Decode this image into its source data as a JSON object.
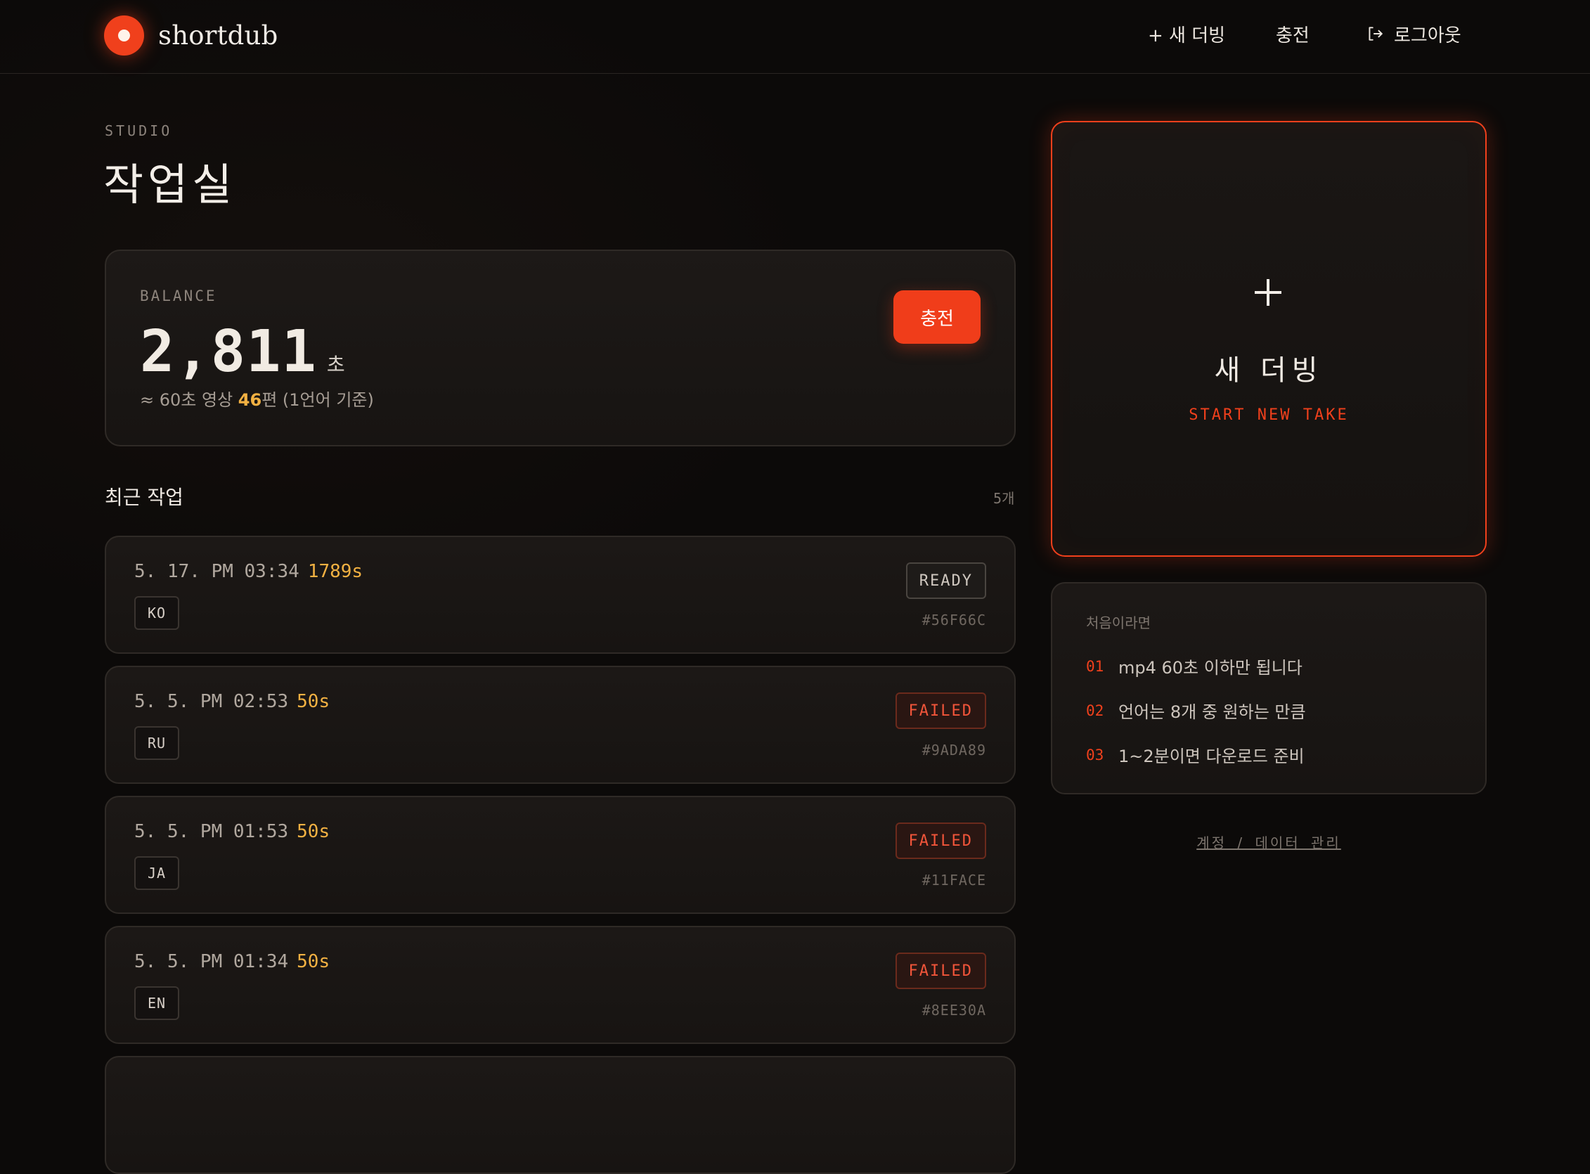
{
  "header": {
    "brand": "shortdub",
    "nav_new": "+ 새 더빙",
    "nav_charge": "충전",
    "nav_logout": "로그아웃"
  },
  "page": {
    "eyebrow": "STUDIO",
    "title": "작업실"
  },
  "balance": {
    "label": "BALANCE",
    "value": "2,811",
    "unit": "초",
    "note_prefix": "≈ 60초 영상 ",
    "note_count": "46",
    "note_suffix": "편 (1언어 기준)",
    "charge_label": "충전"
  },
  "recent": {
    "title": "최근 작업",
    "count": "5개",
    "jobs": [
      {
        "datetime": "5. 17. PM 03:34",
        "duration": "1789s",
        "lang": "KO",
        "status": "READY",
        "id": "#56F66C"
      },
      {
        "datetime": "5. 5. PM 02:53",
        "duration": "50s",
        "lang": "RU",
        "status": "FAILED",
        "id": "#9ADA89"
      },
      {
        "datetime": "5. 5. PM 01:53",
        "duration": "50s",
        "lang": "JA",
        "status": "FAILED",
        "id": "#11FACE"
      },
      {
        "datetime": "5. 5. PM 01:34",
        "duration": "50s",
        "lang": "EN",
        "status": "FAILED",
        "id": "#8EE30A"
      }
    ]
  },
  "new_dub": {
    "title": "새 더빙",
    "subtitle": "START NEW TAKE"
  },
  "guide": {
    "title": "처음이라면",
    "items": [
      {
        "num": "01",
        "text": "mp4 60초 이하만 됩니다"
      },
      {
        "num": "02",
        "text": "언어는 8개 중 원하는 만큼"
      },
      {
        "num": "03",
        "text": "1~2분이면 다운로드 준비"
      }
    ]
  },
  "footer": {
    "account_link": "계정 / 데이터 관리"
  },
  "colors": {
    "accent": "#f0401c",
    "highlight": "#f2b142",
    "background": "#0c0a09"
  },
  "icons": {
    "logo": "record-dot-icon",
    "logout": "logout-arrow-icon",
    "plus": "plus-icon"
  }
}
